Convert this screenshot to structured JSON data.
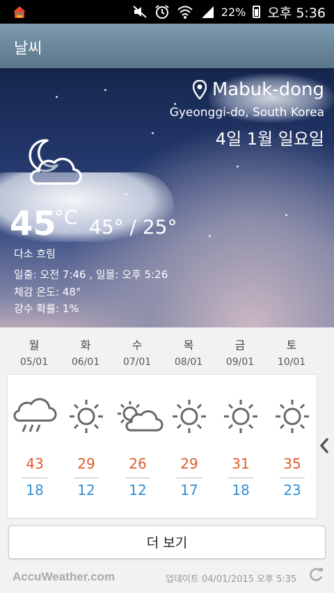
{
  "statusbar": {
    "battery": "22%",
    "time": "오후 5:36"
  },
  "app": {
    "title": "날씨"
  },
  "current": {
    "location": "Mabuk-dong",
    "region": "Gyeonggi-do, South Korea",
    "date": "4일 1월 일요일",
    "temp": "45",
    "unit": "°C",
    "hilo": "45° / 25°",
    "condition": "다소 흐림",
    "sun": "일출: 오전 7:46 , 일몰: 오후 5:26",
    "feels": "체감 온도: 48°",
    "precip": "강수 확률: 1%",
    "icon": "moon-cloud-icon"
  },
  "forecast": [
    {
      "day": "월",
      "date": "05/01",
      "icon": "rain-icon",
      "hi": "43",
      "lo": "18"
    },
    {
      "day": "화",
      "date": "06/01",
      "icon": "sun-icon",
      "hi": "29",
      "lo": "12"
    },
    {
      "day": "수",
      "date": "07/01",
      "icon": "sun-cloud-icon",
      "hi": "26",
      "lo": "12"
    },
    {
      "day": "목",
      "date": "08/01",
      "icon": "sun-icon",
      "hi": "29",
      "lo": "17"
    },
    {
      "day": "금",
      "date": "09/01",
      "icon": "sun-icon",
      "hi": "31",
      "lo": "18"
    },
    {
      "day": "토",
      "date": "10/01",
      "icon": "sun-icon",
      "hi": "35",
      "lo": "23"
    }
  ],
  "more_label": "더 보기",
  "footer": {
    "brand": "AccuWeather.com",
    "updated": "업데이트 04/01/2015 오후 5:35"
  },
  "colors": {
    "hi": "#e05a2b",
    "lo": "#2f8ed3",
    "actionbar": "#6b879b"
  }
}
